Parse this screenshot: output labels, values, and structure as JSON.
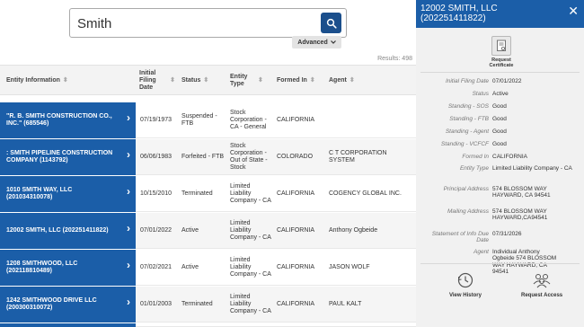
{
  "search": {
    "value": "Smith",
    "advanced_label": "Advanced"
  },
  "results_label": "Results: 498",
  "columns": [
    "Entity Information",
    "Initial Filing Date",
    "Status",
    "Entity Type",
    "Formed In",
    "Agent"
  ],
  "rows": [
    {
      "name": "\"R. B. SMITH CONSTRUCTION CO., INC.\" (685546)",
      "filing_date": "07/19/1973",
      "status": "Suspended - FTB",
      "entity_type": "Stock Corporation - CA - General",
      "formed_in": "CALIFORNIA",
      "agent": ""
    },
    {
      "name": ": SMITH PIPELINE CONSTRUCTION COMPANY (1143792)",
      "filing_date": "06/06/1983",
      "status": "Forfeited - FTB",
      "entity_type": "Stock Corporation - Out of State - Stock",
      "formed_in": "COLORADO",
      "agent": "C T CORPORATION SYSTEM"
    },
    {
      "name": "1010 SMITH WAY, LLC (201034310078)",
      "filing_date": "10/15/2010",
      "status": "Terminated",
      "entity_type": "Limited Liability Company - CA",
      "formed_in": "CALIFORNIA",
      "agent": "COGENCY GLOBAL INC."
    },
    {
      "name": "12002 SMITH, LLC (202251411822)",
      "filing_date": "07/01/2022",
      "status": "Active",
      "entity_type": "Limited Liability Company - CA",
      "formed_in": "CALIFORNIA",
      "agent": "Anthony Ogbeide"
    },
    {
      "name": "1208 SMITHWOOD, LLC (202118810489)",
      "filing_date": "07/02/2021",
      "status": "Active",
      "entity_type": "Limited Liability Company - CA",
      "formed_in": "CALIFORNIA",
      "agent": "JASON WOLF"
    },
    {
      "name": "1242 SMITHWOOD DRIVE LLC (200300310072)",
      "filing_date": "01/01/2003",
      "status": "Terminated",
      "entity_type": "Limited Liability Company - CA",
      "formed_in": "CALIFORNIA",
      "agent": "PAUL KALT"
    }
  ],
  "panel": {
    "title": "12002 SMITH, LLC (202251411822)",
    "request_certificate": "Request Certificate",
    "details": [
      {
        "label": "Initial Filing Date",
        "value": "07/01/2022"
      },
      {
        "label": "Status",
        "value": "Active"
      },
      {
        "label": "Standing - SOS",
        "value": "Good"
      },
      {
        "label": "Standing - FTB",
        "value": "Good"
      },
      {
        "label": "Standing - Agent",
        "value": "Good"
      },
      {
        "label": "Standing - VCFCF",
        "value": "Good"
      },
      {
        "label": "Formed In",
        "value": "CALIFORNIA"
      },
      {
        "label": "Entity Type",
        "value": "Limited Liability Company - CA"
      },
      {
        "label": "Principal Address",
        "value": "574 BLOSSOM WAY HAYWARD, CA 94541"
      },
      {
        "label": "Mailing Address",
        "value": "574 BLOSSOM WAY HAYWARD,CA94541"
      },
      {
        "label": "Statement of Info Due Date",
        "value": "07/31/2026"
      },
      {
        "label": "Agent",
        "value": "Individual Anthony Ogbeide 574 BLOSSOM WAY HAYWARD, CA 94541"
      }
    ],
    "view_history": "View History",
    "request_access": "Request Access"
  },
  "colors": {
    "primary": "#1b5ea8",
    "search_button": "#1b4f8c",
    "panel_bg": "#f1f1f1"
  },
  "icons": [
    "search-icon",
    "chevron-down-icon",
    "sort-icon",
    "chevron-right-icon",
    "close-icon",
    "certificate-icon",
    "history-icon",
    "people-icon"
  ]
}
